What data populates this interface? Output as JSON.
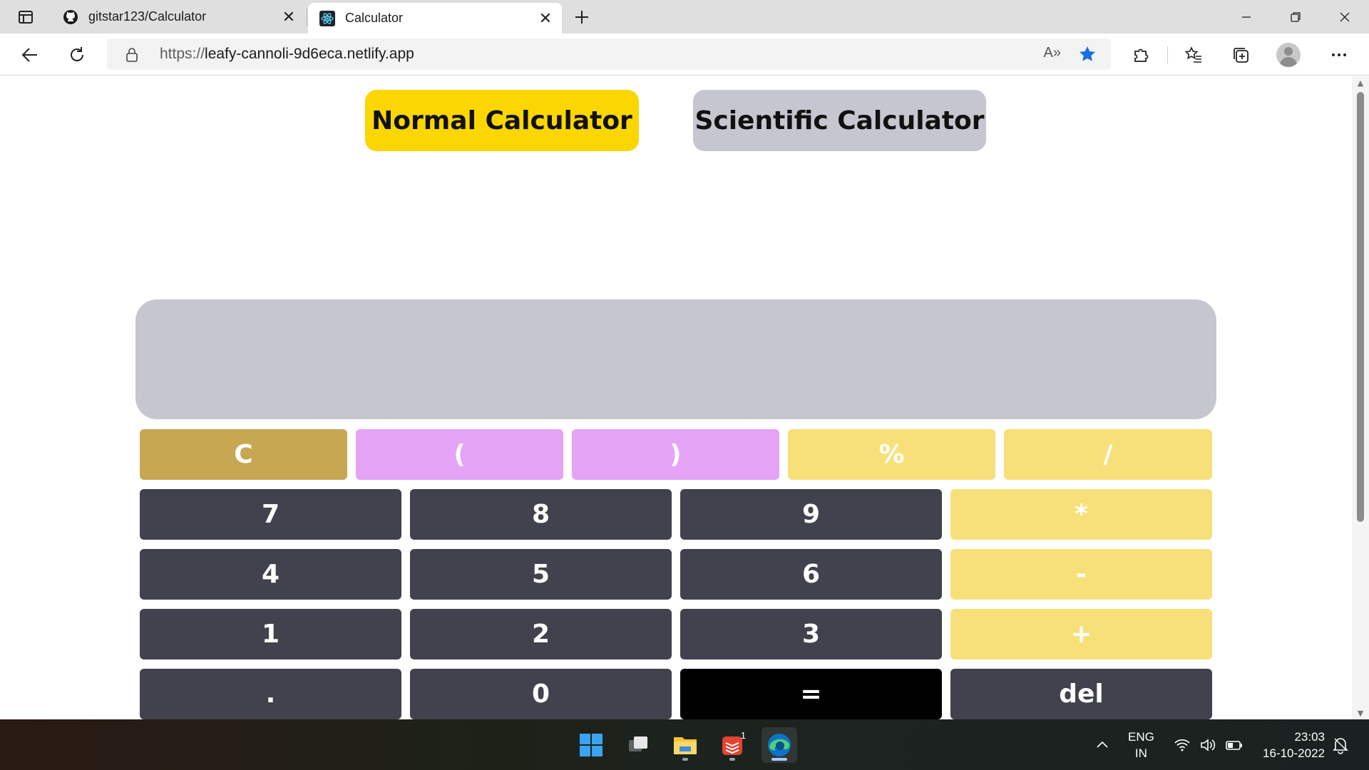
{
  "browser": {
    "tabs": [
      {
        "title": "gitstar123/Calculator",
        "icon": "github-icon",
        "active": false
      },
      {
        "title": "Calculator",
        "icon": "react-icon",
        "active": true
      }
    ],
    "url_protocol": "https://",
    "url_host": "leafy-cannoli-9d6eca.netlify.app",
    "read_aloud_label": "A»"
  },
  "page": {
    "mode_buttons": {
      "normal": "Normal Calculator",
      "scientific": "Scientific Calculator"
    },
    "display_value": "",
    "keys": {
      "clear": "C",
      "open_paren": "(",
      "close_paren": ")",
      "percent": "%",
      "divide": "/",
      "seven": "7",
      "eight": "8",
      "nine": "9",
      "multiply": "*",
      "four": "4",
      "five": "5",
      "six": "6",
      "minus": "-",
      "one": "1",
      "two": "2",
      "three": "3",
      "plus": "+",
      "dot": ".",
      "zero": "0",
      "equals": "=",
      "del": "del"
    }
  },
  "taskbar": {
    "todoist_badge": "1",
    "language": "ENG",
    "region": "IN",
    "time": "23:03",
    "date": "16-10-2022"
  },
  "colors": {
    "normal_btn": "#fbd601",
    "scientific_btn": "#c6c6d0",
    "display": "#c6c6d0",
    "clear_key": "#c7a752",
    "paren_key": "#e4a3f5",
    "operator_key": "#f7e07a",
    "number_key": "#41424d",
    "equals_key": "#000000"
  }
}
